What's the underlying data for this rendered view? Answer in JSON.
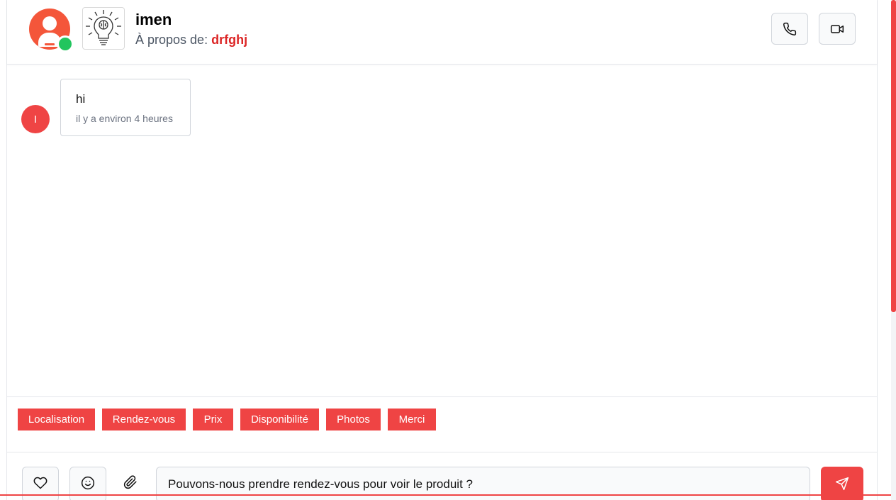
{
  "header": {
    "contact_name": "imen",
    "about_label": "À propos de:",
    "product_name": "drfghj",
    "online_status": "online",
    "call_icon": "phone-icon",
    "video_icon": "video-camera-icon",
    "product_image_icon": "lightbulb-brain-icon"
  },
  "messages": [
    {
      "sender_initial": "I",
      "text": "hi",
      "time": "il y a environ 4 heures"
    }
  ],
  "quick_replies": [
    "Localisation",
    "Rendez-vous",
    "Prix",
    "Disponibilité",
    "Photos",
    "Merci"
  ],
  "composer": {
    "input_value": "Pouvons-nous prendre rendez-vous pour voir le produit ?",
    "like_icon": "heart-icon",
    "emoji_icon": "smiley-icon",
    "attach_icon": "paperclip-icon",
    "send_icon": "send-icon"
  },
  "colors": {
    "accent": "#ef4444",
    "product_link": "#dc2626",
    "avatar": "#f4563a",
    "online": "#22c55e"
  }
}
